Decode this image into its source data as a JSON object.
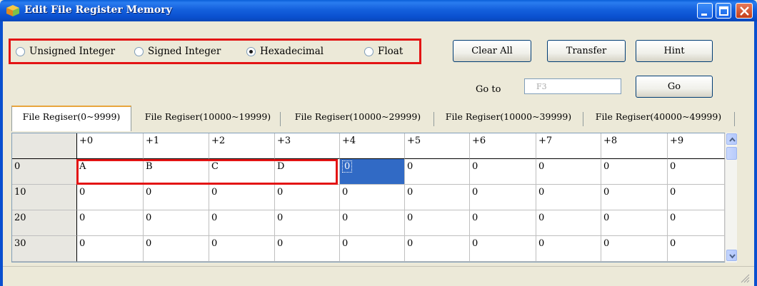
{
  "window": {
    "title": "Edit File Register Memory",
    "icon": "cube-icon"
  },
  "format": {
    "options": [
      {
        "label": "Unsigned Integer",
        "selected": false
      },
      {
        "label": "Signed Integer",
        "selected": false
      },
      {
        "label": "Hexadecimal",
        "selected": true
      },
      {
        "label": "Float",
        "selected": false
      }
    ]
  },
  "buttons": {
    "clear_all": "Clear All",
    "transfer": "Transfer",
    "hint": "Hint",
    "go": "Go"
  },
  "goto": {
    "label": "Go to",
    "value": "F3"
  },
  "tabs": [
    {
      "label": "File Regiser(0~9999)",
      "active": true
    },
    {
      "label": "File Regiser(10000~19999)",
      "active": false
    },
    {
      "label": "File Regiser(10000~29999)",
      "active": false
    },
    {
      "label": "File Regiser(10000~39999)",
      "active": false
    },
    {
      "label": "File Regiser(40000~49999)",
      "active": false
    }
  ],
  "grid": {
    "columns": [
      "+0",
      "+1",
      "+2",
      "+3",
      "+4",
      "+5",
      "+6",
      "+7",
      "+8",
      "+9"
    ],
    "rows": [
      {
        "label": "0",
        "values": [
          "A",
          "B",
          "C",
          "D",
          "0",
          "0",
          "0",
          "0",
          "0",
          "0"
        ]
      },
      {
        "label": "10",
        "values": [
          "0",
          "0",
          "0",
          "0",
          "0",
          "0",
          "0",
          "0",
          "0",
          "0"
        ]
      },
      {
        "label": "20",
        "values": [
          "0",
          "0",
          "0",
          "0",
          "0",
          "0",
          "0",
          "0",
          "0",
          "0"
        ]
      },
      {
        "label": "30",
        "values": [
          "0",
          "0",
          "0",
          "0",
          "0",
          "0",
          "0",
          "0",
          "0",
          "0"
        ]
      }
    ],
    "selected_cell": {
      "row": 0,
      "col": 4
    }
  },
  "colors": {
    "highlight": "#e31414",
    "selection": "#316ac5",
    "titlebar": "#0a50cf"
  }
}
